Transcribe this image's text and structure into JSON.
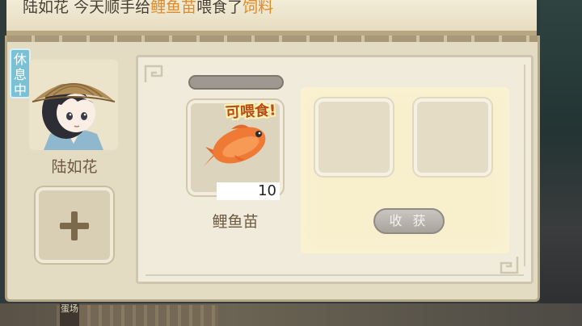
{
  "message": {
    "name": "陆如花",
    "action": "今天顺手给",
    "item": "鲤鱼苗",
    "action2": "喂食了",
    "object": "饲料"
  },
  "worker": {
    "status_badge": "休息中",
    "name": "陆如花"
  },
  "feed_item": {
    "tag": "可喂食!",
    "count": "10",
    "name": "鲤鱼苗"
  },
  "harvest": {
    "button_label": "收 获"
  },
  "scene": {
    "sign_text": "蛋场"
  },
  "colors": {
    "highlight": "#e08a2a",
    "panel": "#e4dbc3",
    "badge": "#7bc1d6"
  }
}
